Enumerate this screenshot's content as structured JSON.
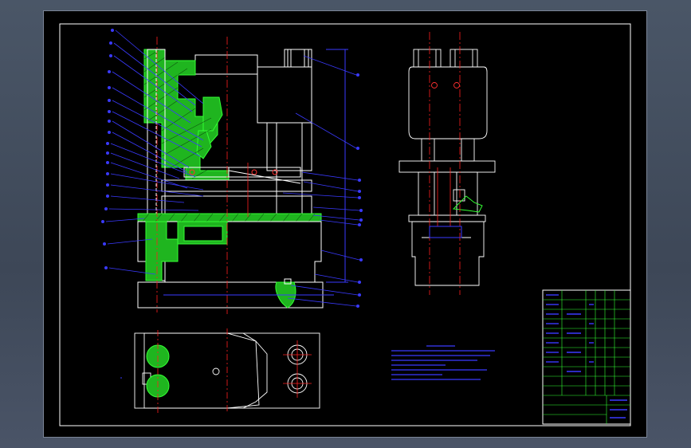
{
  "drawing": {
    "sheet": "A3",
    "colors": {
      "background": "#000000",
      "border": "#ffffff",
      "hatch": "#33ff33",
      "leader": "#3a3aff",
      "center_line": "#ff2020",
      "outline": "#ffffff",
      "text": "#3a3aff",
      "title_grid": "#33ff33",
      "app_backdrop": "#434d5e"
    },
    "views": [
      "front-section",
      "side-view",
      "top-view"
    ],
    "balloon_count_left": 20,
    "balloon_count_right": 12,
    "notes_lines": 8,
    "title_block_rows": 14
  }
}
